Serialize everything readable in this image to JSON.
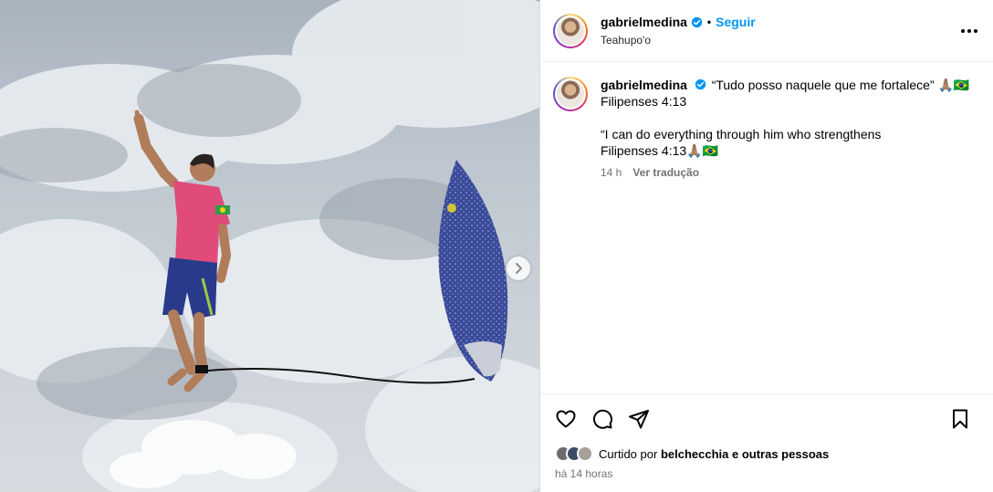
{
  "header": {
    "username": "gabrielmedina",
    "separator": "•",
    "follow_label": "Seguir",
    "location": "Teahupo'o",
    "more_icon": "more-horizontal-icon"
  },
  "caption": {
    "username": "gabrielmedina",
    "text": "“Tudo posso naquele que me fortalece” 🙏🏽🇧🇷\nFilipenses 4:13\n\n“I can do everything through him who strengthens\nFilipenses 4:13🙏🏽🇧🇷",
    "age": "14 h",
    "translate_label": "Ver tradução"
  },
  "actions": {
    "like_icon": "heart-icon",
    "comment_icon": "comment-icon",
    "share_icon": "send-icon",
    "save_icon": "bookmark-icon"
  },
  "likes": {
    "prefix": "Curtido por",
    "user": "belchecchia",
    "suffix": "e outras pessoas"
  },
  "timestamp": "há 14 horas",
  "colors": {
    "accent": "#0095f6",
    "verified": "#0095f6",
    "shirt": "#e04b7a",
    "shorts": "#2a3a8a",
    "board": "#3a4a9a"
  }
}
